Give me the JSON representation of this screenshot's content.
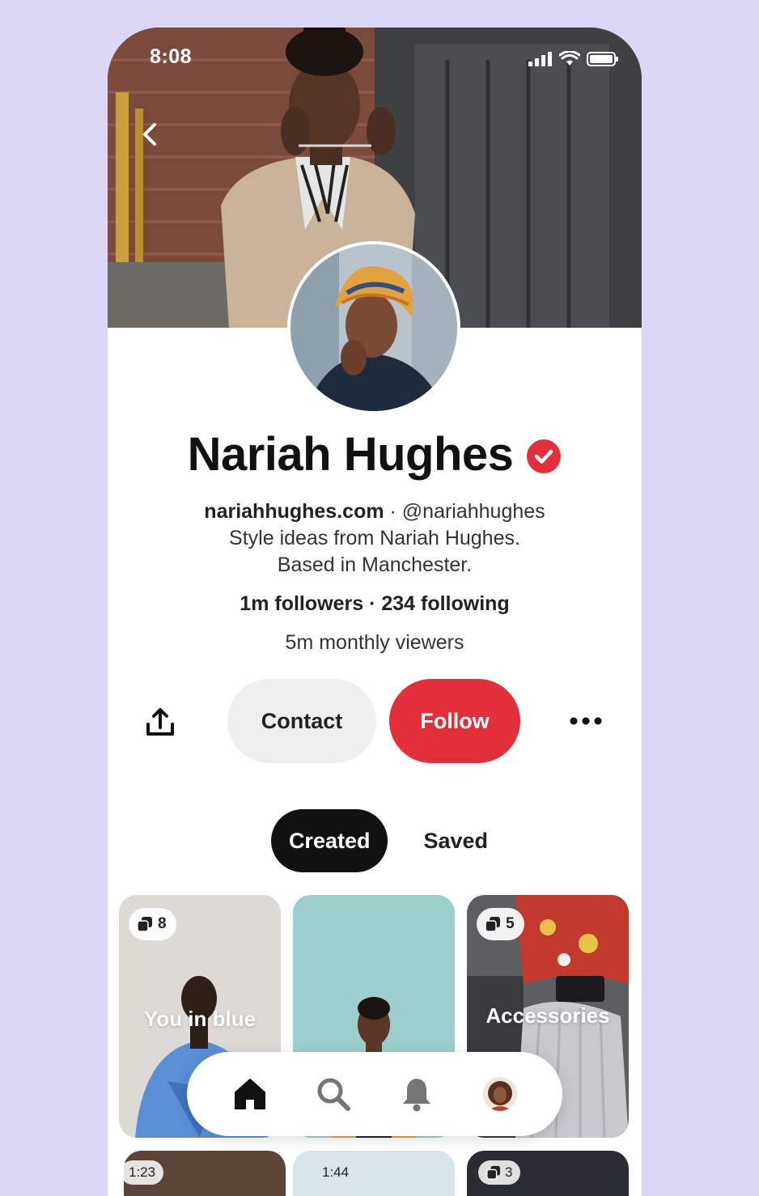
{
  "status_bar": {
    "time": "8:08"
  },
  "profile": {
    "name": "Nariah Hughes",
    "website": "nariahhughes.com",
    "separator": " · ",
    "handle": "@nariahhughes",
    "bio_line1": "Style ideas from Nariah Hughes.",
    "bio_line2": "Based in Manchester.",
    "followers": "1m followers",
    "following": "234 following",
    "monthly_viewers": "5m monthly viewers"
  },
  "actions": {
    "contact_label": "Contact",
    "follow_label": "Follow"
  },
  "tabs": [
    {
      "label": "Created",
      "active": true
    },
    {
      "label": "Saved",
      "active": false
    }
  ],
  "boards": [
    {
      "title": "You in blue",
      "count": "8"
    },
    {
      "title": "",
      "count": ""
    },
    {
      "title": "Accessories",
      "count": "5"
    }
  ],
  "row2": [
    {
      "label": "1:23"
    },
    {
      "label": "1:44"
    },
    {
      "label": "3"
    }
  ],
  "nav": {
    "items": [
      "home-icon",
      "search-icon",
      "bell-icon",
      "profile-avatar"
    ]
  },
  "colors": {
    "background": "#dcd7f6",
    "follow": "#e1303c",
    "verified": "#e1303c",
    "contact": "#efefef",
    "active_tab": "#111111"
  }
}
